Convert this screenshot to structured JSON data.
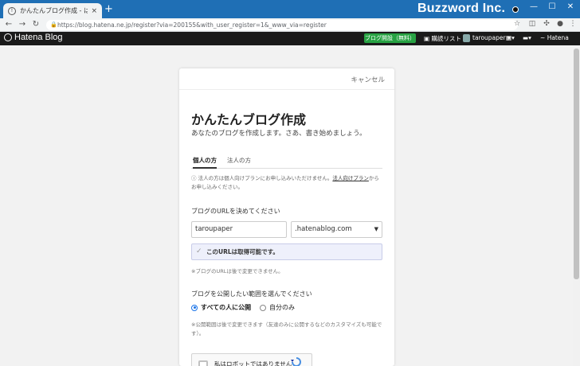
{
  "browser": {
    "tab_title": "かんたんブログ作成 - はてなブログ",
    "tab_close": "×",
    "new_tab": "+",
    "brand": "Buzzword Inc.",
    "url": "https://blog.hatena.ne.jp/register?via=200155&with_user_register=1&_www_via=register",
    "controls": {
      "minimize": "—",
      "maximize": "☐",
      "close": "✕"
    }
  },
  "header": {
    "logo": "Hatena Blog",
    "create_button": "ブログ開設（無料）",
    "reading_list": "購読リスト",
    "username": "taroupaper",
    "hatena": "Hatena"
  },
  "form": {
    "cancel": "キャンセル",
    "title": "かんたんブログ作成",
    "subtitle": "あなたのブログを作成します。さあ、書き始めましょう。",
    "tabs": [
      "個人の方",
      "法人の方"
    ],
    "notice_pre": "ⓘ 法人の方は個人向けプランにお申し込みいただけません。",
    "notice_link": "法人向けプラン",
    "notice_post": "からお申し込みください。",
    "url_label": "ブログのURLを決めてください",
    "subdomain_value": "taroupaper",
    "domain_value": ".hatenablog.com",
    "availability": "このURLは取得可能です。",
    "url_note": "※ブログのURLは後で変更できません。",
    "visibility_label": "ブログを公開したい範囲を選んでください",
    "visibility_options": [
      "すべての人に公開",
      "自分のみ"
    ],
    "visibility_selected": "すべての人に公開",
    "visibility_note": "※公開範囲は後で変更できます（友達のみに公開するなどのカスタマイズも可能です）。",
    "captcha_text": "私はロボットではありません"
  },
  "colors": {
    "titlebar": "#1f6fb5",
    "header_bg": "#1a1a1a",
    "create_button": "#27a243",
    "availability_bg": "#eef0fb"
  }
}
